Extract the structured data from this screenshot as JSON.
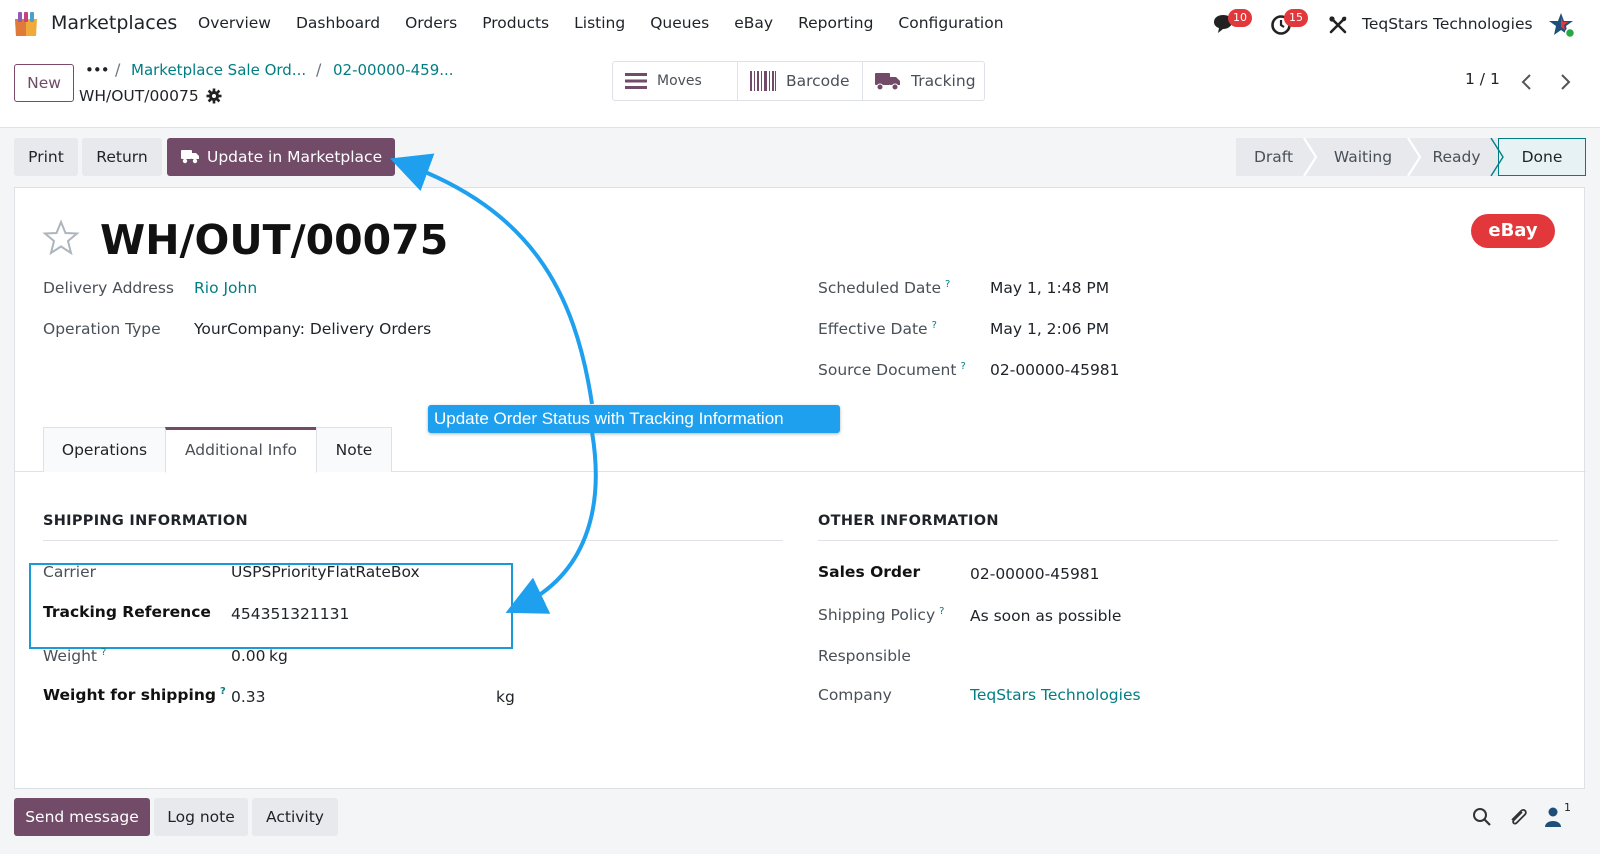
{
  "topnav": {
    "app_name": "Marketplaces",
    "menu": [
      "Overview",
      "Dashboard",
      "Orders",
      "Products",
      "Listing",
      "Queues",
      "eBay",
      "Reporting",
      "Configuration"
    ],
    "chat_count": "10",
    "activity_count": "15",
    "company": "TeqStars Technologies"
  },
  "control": {
    "new_label": "New",
    "dots": "•••",
    "breadcrumb_1": "Marketplace Sale Ord...",
    "breadcrumb_2": "02-00000-459...",
    "record_name": "WH/OUT/00075",
    "smart_buttons": {
      "moves": "Moves",
      "barcode": "Barcode",
      "tracking": "Tracking"
    },
    "pager": "1 / 1"
  },
  "statusbar": {
    "print": "Print",
    "return": "Return",
    "update": "Update in Marketplace",
    "stages": [
      "Draft",
      "Waiting",
      "Ready",
      "Done"
    ]
  },
  "sheet": {
    "title": "WH/OUT/00075",
    "marketplace_badge": "eBay",
    "delivery_address_label": "Delivery Address",
    "delivery_address": "Rio John",
    "operation_type_label": "Operation Type",
    "operation_type": "YourCompany: Delivery Orders",
    "scheduled_date_label": "Scheduled Date",
    "scheduled_date": "May 1, 1:48 PM",
    "effective_date_label": "Effective Date",
    "effective_date": "May 1, 2:06 PM",
    "source_document_label": "Source Document",
    "source_document": "02-00000-45981",
    "help_mark": "?",
    "tabs": [
      "Operations",
      "Additional Info",
      "Note"
    ]
  },
  "shipping": {
    "title": "SHIPPING INFORMATION",
    "carrier_label": "Carrier",
    "carrier": "USPSPriorityFlatRateBox",
    "tracking_label": "Tracking Reference",
    "tracking": "454351321131",
    "weight_label": "Weight",
    "weight": "0.00",
    "weight_unit": "kg",
    "weight_ship_label": "Weight for shipping",
    "weight_ship": "0.33",
    "weight_ship_unit": "kg"
  },
  "other": {
    "title": "OTHER INFORMATION",
    "sales_order_label": "Sales Order",
    "sales_order": "02-00000-45981",
    "shipping_policy_label": "Shipping Policy",
    "shipping_policy": "As soon as possible",
    "responsible_label": "Responsible",
    "company_label": "Company",
    "company": "TeqStars Technologies"
  },
  "annotation": {
    "callout": "Update Order Status with Tracking Information"
  },
  "chatter": {
    "send": "Send message",
    "log": "Log note",
    "activity": "Activity",
    "followers": "1"
  },
  "colors": {
    "brand": "#714b67",
    "link": "#017e84",
    "badge_red": "#e2383c",
    "annotation_blue": "#1ea0ee"
  }
}
